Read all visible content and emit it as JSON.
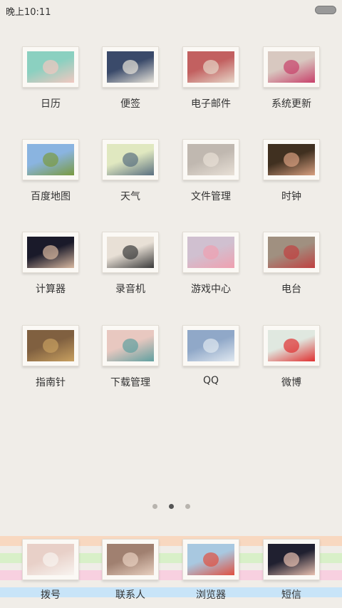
{
  "status": {
    "time": "晚上10:11"
  },
  "apps": [
    {
      "label": "日历",
      "icon": "calendar-photo",
      "colors": [
        "#8bd0c0",
        "#f2c8c0"
      ]
    },
    {
      "label": "便签",
      "icon": "note-photo",
      "colors": [
        "#3a4a6a",
        "#e8e4da"
      ]
    },
    {
      "label": "电子邮件",
      "icon": "mail-photo",
      "colors": [
        "#c26060",
        "#e6d6c8"
      ]
    },
    {
      "label": "系统更新",
      "icon": "flowers-photo",
      "colors": [
        "#d8c8c0",
        "#c8406a"
      ]
    },
    {
      "label": "百度地图",
      "icon": "road-photo",
      "colors": [
        "#8ab4e0",
        "#7a9a40"
      ]
    },
    {
      "label": "天气",
      "icon": "umbrella-photo",
      "colors": [
        "#e0e8c0",
        "#5a7080"
      ]
    },
    {
      "label": "文件管理",
      "icon": "book-photo",
      "colors": [
        "#c0b8b0",
        "#e8e0d6"
      ]
    },
    {
      "label": "时钟",
      "icon": "clock-photo",
      "colors": [
        "#403020",
        "#d8a080"
      ]
    },
    {
      "label": "计算器",
      "icon": "hand-photo",
      "colors": [
        "#1a1a2a",
        "#d8b8a0"
      ]
    },
    {
      "label": "录音机",
      "icon": "cassette-photo",
      "colors": [
        "#e8e0d6",
        "#3a3a3a"
      ]
    },
    {
      "label": "游戏中心",
      "icon": "cat-photo",
      "colors": [
        "#d0c0d0",
        "#f0a0b0"
      ]
    },
    {
      "label": "电台",
      "icon": "radio-photo",
      "colors": [
        "#a09080",
        "#c04040"
      ]
    },
    {
      "label": "指南针",
      "icon": "compass-photo",
      "colors": [
        "#806040",
        "#c8a060"
      ]
    },
    {
      "label": "下载管理",
      "icon": "flamingo-photo",
      "colors": [
        "#e8c8c0",
        "#60a0a0"
      ]
    },
    {
      "label": "QQ",
      "icon": "penguin-photo",
      "colors": [
        "#90a8c8",
        "#e0e8f0"
      ]
    },
    {
      "label": "微博",
      "icon": "bird-photo",
      "colors": [
        "#e0e8e0",
        "#e03030"
      ]
    }
  ],
  "page_indicator": {
    "count": 3,
    "active_index": 1
  },
  "dock": {
    "stripes": [
      "#f8d8c0",
      "#d8f0c8",
      "#f8d0e0",
      "#c8e4f8"
    ],
    "items": [
      {
        "label": "拨号",
        "icon": "phone-photo",
        "colors": [
          "#e8d0c8",
          "#f8f4f0"
        ]
      },
      {
        "label": "联系人",
        "icon": "face-photo",
        "colors": [
          "#a08070",
          "#e8d0c0"
        ]
      },
      {
        "label": "浏览器",
        "icon": "balloons-photo",
        "colors": [
          "#a8c8e0",
          "#e05040"
        ]
      },
      {
        "label": "短信",
        "icon": "hand-photo-2",
        "colors": [
          "#202030",
          "#e8c0b0"
        ]
      }
    ]
  }
}
